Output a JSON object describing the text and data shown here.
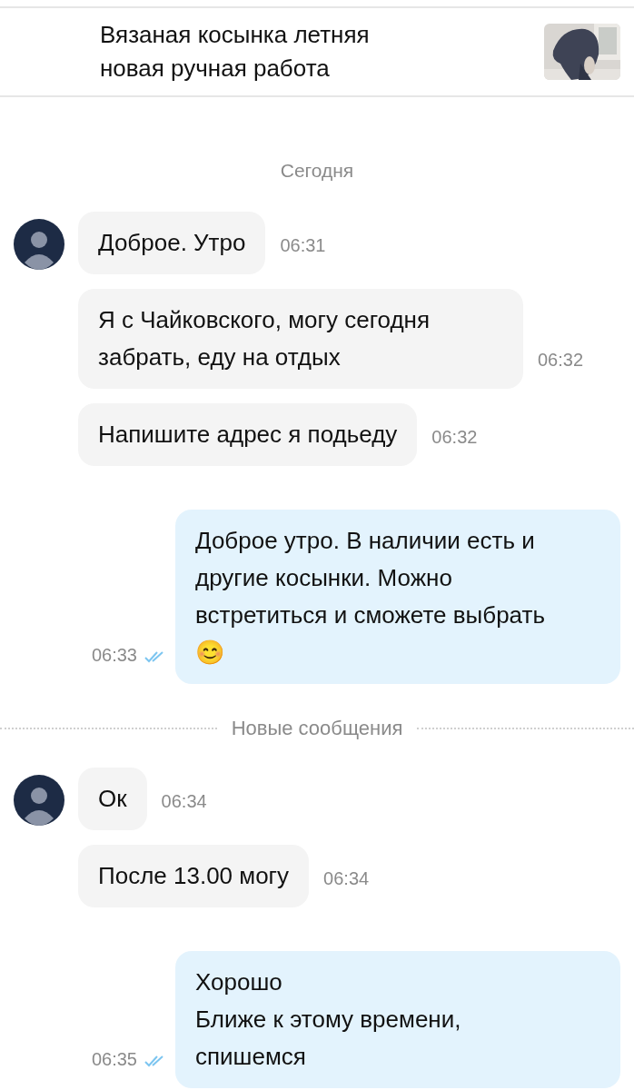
{
  "header": {
    "title": "Вязаная косынка летняя\nновая ручная работа"
  },
  "messages": [
    {
      "kind": "date",
      "text": "Сегодня"
    },
    {
      "kind": "incoming",
      "avatar": true,
      "text": "Доброе.  Утро",
      "time": "06:31"
    },
    {
      "kind": "incoming",
      "avatar": false,
      "text": "Я  с Чайковского, могу сегодня забрать, еду на отдых",
      "time": "06:32"
    },
    {
      "kind": "incoming",
      "avatar": false,
      "text": "Напишите адрес я подьеду",
      "time": "06:32"
    },
    {
      "kind": "outgoing",
      "read": true,
      "text": "Доброе утро. В наличии есть и другие косынки. Можно встретиться и сможете выбрать 😊",
      "time": "06:33"
    },
    {
      "kind": "divider",
      "text": "Новые сообщения"
    },
    {
      "kind": "incoming",
      "avatar": true,
      "text": "Ок",
      "time": "06:34"
    },
    {
      "kind": "incoming",
      "avatar": false,
      "text": "После 13.00 могу",
      "time": "06:34"
    },
    {
      "kind": "outgoing",
      "read": true,
      "text": "Хорошо\nБлиже к этому времени, спишемся",
      "time": "06:35"
    }
  ]
}
